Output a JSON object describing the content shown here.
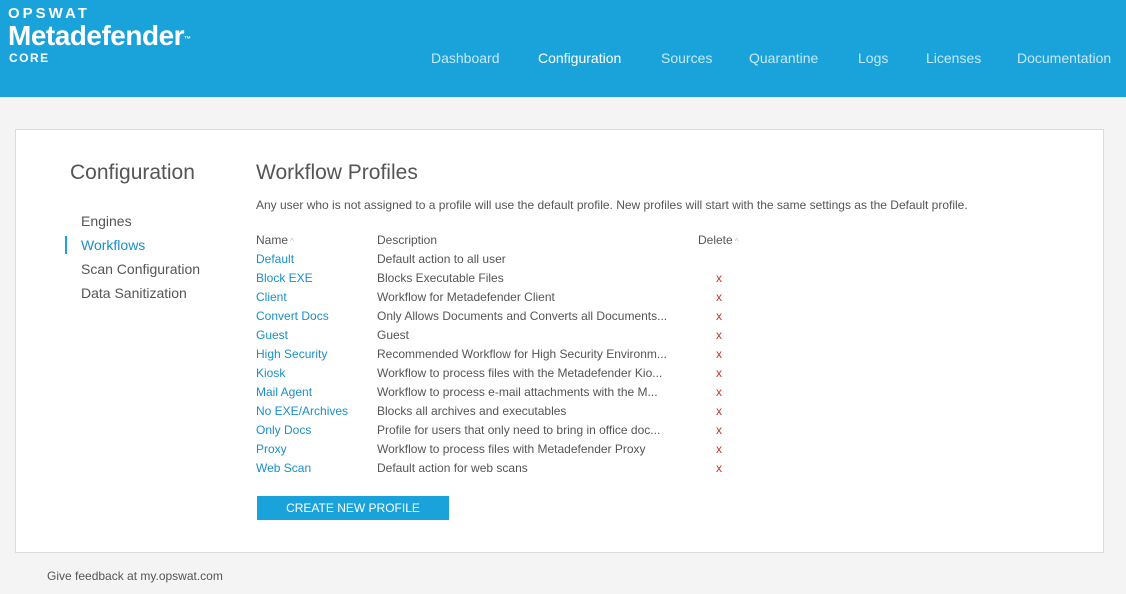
{
  "header": {
    "brand": "OPSWAT",
    "product": "Metadefender",
    "trademark": "™",
    "edition": "CORE",
    "nav": [
      {
        "label": "Dashboard",
        "active": false
      },
      {
        "label": "Configuration",
        "active": true
      },
      {
        "label": "Sources",
        "active": false
      },
      {
        "label": "Quarantine",
        "active": false
      },
      {
        "label": "Logs",
        "active": false
      },
      {
        "label": "Licenses",
        "active": false
      },
      {
        "label": "Documentation",
        "active": false
      }
    ]
  },
  "sidebar": {
    "title": "Configuration",
    "items": [
      {
        "label": "Engines",
        "active": false
      },
      {
        "label": "Workflows",
        "active": true
      },
      {
        "label": "Scan Configuration",
        "active": false
      },
      {
        "label": "Data Sanitization",
        "active": false
      }
    ]
  },
  "main": {
    "title": "Workflow Profiles",
    "description": "Any user who is not assigned to a profile will use the default profile. New profiles will start with the same settings as the Default profile.",
    "columns": {
      "name": "Name",
      "description": "Description",
      "delete": "Delete",
      "sort_icon": "^"
    },
    "rows": [
      {
        "name": "Default",
        "description": "Default action to all user",
        "delete": ""
      },
      {
        "name": "Block EXE",
        "description": "Blocks Executable Files",
        "delete": "x"
      },
      {
        "name": "Client",
        "description": "Workflow for Metadefender Client",
        "delete": "x"
      },
      {
        "name": "Convert Docs",
        "description": "Only Allows Documents and Converts all Documents...",
        "delete": "x"
      },
      {
        "name": "Guest",
        "description": "Guest",
        "delete": "x"
      },
      {
        "name": "High Security",
        "description": "Recommended Workflow for High Security Environm...",
        "delete": "x"
      },
      {
        "name": "Kiosk",
        "description": "Workflow to process files with the Metadefender Kio...",
        "delete": "x"
      },
      {
        "name": "Mail Agent",
        "description": "Workflow to process e-mail attachments with the M...",
        "delete": "x"
      },
      {
        "name": "No EXE/Archives",
        "description": "Blocks all archives and executables",
        "delete": "x"
      },
      {
        "name": "Only Docs",
        "description": "Profile for users that only need to bring in office doc...",
        "delete": "x"
      },
      {
        "name": "Proxy",
        "description": "Workflow to process files with Metadefender Proxy",
        "delete": "x"
      },
      {
        "name": "Web Scan",
        "description": "Default action for web scans",
        "delete": "x"
      }
    ],
    "create_button": "CREATE NEW PROFILE"
  },
  "footer": {
    "text": "Give feedback at my.opswat.com"
  },
  "colors": {
    "header": "#1aa3db",
    "link": "#1a8fc9",
    "delete": "#c0392b",
    "button": "#1aa3db"
  }
}
